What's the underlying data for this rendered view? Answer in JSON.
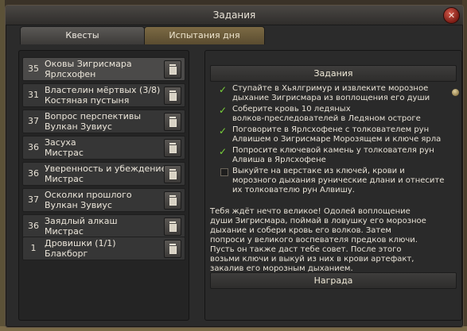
{
  "window": {
    "title": "Задания",
    "close_icon": "close-icon"
  },
  "tabs": [
    {
      "label": "Квесты",
      "active": true
    },
    {
      "label": "Испытания дня",
      "active": false
    }
  ],
  "quests": [
    {
      "level": "35",
      "name": "Оковы Зигрисмара",
      "location": "Ярлсхофен",
      "selected": true
    },
    {
      "level": "31",
      "name": "Властелин мёртвых (3/8)",
      "location": "Костяная пустыня"
    },
    {
      "level": "37",
      "name": "Вопрос перспективы",
      "location": "Вулкан Зувиус"
    },
    {
      "level": "36",
      "name": "Засуха",
      "location": "Мистрас"
    },
    {
      "level": "36",
      "name": "Уверенность и убеждение",
      "location": "Мистрас"
    },
    {
      "level": "37",
      "name": "Осколки прошлого",
      "location": "Вулкан Зувиус"
    },
    {
      "level": "36",
      "name": "Заядлый алкаш",
      "location": "Мистрас"
    },
    {
      "level": "1",
      "name": "Дровишки (1/1)",
      "location": "Блакборг"
    }
  ],
  "details": {
    "tasks_header": "Задания",
    "tasks": [
      {
        "done": true,
        "lines": [
          "Ступайте в Хьялгримур и извлеките морозное",
          "дыхание Зигрисмара из воплощения его души"
        ]
      },
      {
        "done": true,
        "lines": [
          "Соберите кровь 10 ледяных",
          "волков-преследователей в Ледяном остроге"
        ]
      },
      {
        "done": true,
        "lines": [
          "Поговорите в Ярлсхофене с толкователем рун",
          "Алвишем о Зигрисмаре Морозящем и ключе ярла"
        ]
      },
      {
        "done": true,
        "lines": [
          "Попросите ключевой камень у толкователя рун",
          "Алвиша в Ярлсхофене"
        ]
      },
      {
        "done": false,
        "lines": [
          "Выкуйте на верстаке из ключей, крови и",
          "морозного дыхания рунические длани и отнесите",
          "их толкователю рун Алвишу."
        ]
      }
    ],
    "description_lines": [
      "Тебя ждёт нечто великое! Одолей воплощение",
      "души Зигрисмара, поймай в ловушку его морозное",
      "дыхание и собери кровь его волков. Затем",
      "попроси у великого воспевателя предков ключи.",
      "Пусть он также даст тебе совет. После этого",
      "возьми ключи и выкуй из них в крови артефакт,",
      "закалив его морозным дыханием."
    ],
    "reward_header": "Награда"
  }
}
